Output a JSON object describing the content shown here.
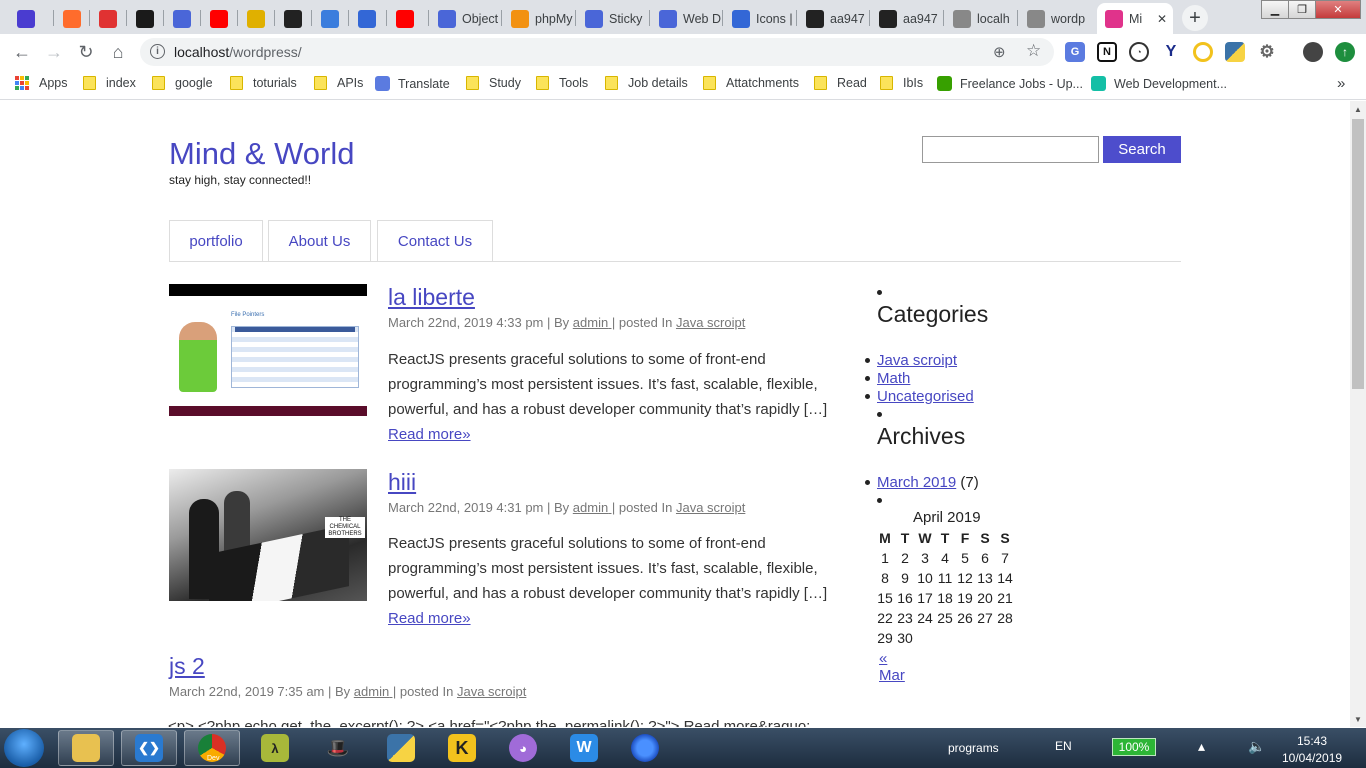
{
  "browser": {
    "tabs": [
      {
        "label": "",
        "icon": "yahoo-icon",
        "color": "#4a3cd0"
      },
      {
        "label": "",
        "icon": "cpanel-icon",
        "color": "#ff6c2c"
      },
      {
        "label": "",
        "icon": "ox-icon",
        "color": "#e03232"
      },
      {
        "label": "",
        "icon": "marker-icon",
        "color": "#1a1a1a"
      },
      {
        "label": "",
        "icon": "link-icon",
        "color": "#4a66d8"
      },
      {
        "label": "",
        "icon": "youtube-icon",
        "color": "#ff0000"
      },
      {
        "label": "",
        "icon": "crown-icon",
        "color": "#e0b000"
      },
      {
        "label": "",
        "icon": "w-icon",
        "color": "#222"
      },
      {
        "label": "",
        "icon": "phone-icon",
        "color": "#3b7ddd"
      },
      {
        "label": "",
        "icon": "flag-icon",
        "color": "#3367d6"
      },
      {
        "label": "",
        "icon": "youtube-icon",
        "color": "#ff0000"
      },
      {
        "label": "Object",
        "icon": "link-icon",
        "color": "#4a66d8"
      },
      {
        "label": "phpMy",
        "icon": "phpmyadmin-icon",
        "color": "#f29111"
      },
      {
        "label": "Sticky",
        "icon": "link-icon",
        "color": "#4a66d8"
      },
      {
        "label": "Web D",
        "icon": "link-icon",
        "color": "#4a66d8"
      },
      {
        "label": "Icons |",
        "icon": "flag-icon",
        "color": "#3367d6"
      },
      {
        "label": "aa947",
        "icon": "github-icon",
        "color": "#222"
      },
      {
        "label": "aa947",
        "icon": "github-icon",
        "color": "#222"
      },
      {
        "label": "localh",
        "icon": "globe-icon",
        "color": "#888"
      },
      {
        "label": "wordp",
        "icon": "globe-icon",
        "color": "#888"
      },
      {
        "label": "Mi",
        "icon": "m-icon",
        "color": "#e0338b",
        "active": true
      }
    ],
    "url_host": "localhost",
    "url_path": "/wordpress/",
    "bookmarks": [
      {
        "label": "Apps",
        "type": "apps"
      },
      {
        "label": "index",
        "type": "folder"
      },
      {
        "label": "google",
        "type": "folder"
      },
      {
        "label": "toturials",
        "type": "folder"
      },
      {
        "label": "APIs",
        "type": "folder"
      },
      {
        "label": "Translate",
        "type": "translate"
      },
      {
        "label": "Study",
        "type": "folder"
      },
      {
        "label": "Tools",
        "type": "folder"
      },
      {
        "label": "Job details",
        "type": "folder"
      },
      {
        "label": "Attatchments",
        "type": "folder"
      },
      {
        "label": "Read",
        "type": "folder"
      },
      {
        "label": "IbIs",
        "type": "folder"
      },
      {
        "label": "Freelance Jobs - Up...",
        "type": "upwork"
      },
      {
        "label": "Web Development...",
        "type": "web"
      }
    ],
    "more_bookmarks": "»"
  },
  "site": {
    "title": "Mind & World",
    "tagline": "stay high, stay connected!!",
    "search_button": "Search",
    "search_value": "",
    "menu": [
      "portfolio",
      "About Us",
      "Contact Us"
    ]
  },
  "posts": [
    {
      "title": "la liberte",
      "date": "March 22nd, 2019 4:33 pm",
      "by": "By",
      "author": "admin",
      "posted_in": "posted In",
      "category": "Java scroipt",
      "excerpt": "ReactJS presents graceful solutions to some of front-end programming’s most persistent issues. It’s fast, scalable, flexible, powerful, and has a robust developer community that’s rapidly […]",
      "read_more": "Read more»",
      "thumb_text": "File Pointers"
    },
    {
      "title": "hiii",
      "date": "March 22nd, 2019 4:31 pm",
      "by": "By",
      "author": "admin",
      "posted_in": "posted In",
      "category": "Java scroipt",
      "excerpt": "ReactJS presents graceful solutions to some of front-end programming’s most persistent issues. It’s fast, scalable, flexible, powerful, and has a robust developer community that’s rapidly […]",
      "read_more": "Read more»",
      "thumb_text": "THE CHEMICAL BROTHERS"
    },
    {
      "title": "js 2",
      "date": "March 22nd, 2019 7:35 am",
      "by": "By",
      "author": "admin",
      "posted_in": "posted In",
      "category": "Java scroipt",
      "code_excerpt": "<p> <?php echo get_the_excerpt(); ?> <a href=\"<?php the_permalink(); ?>\"> Read more&raquo;"
    }
  ],
  "sidebar": {
    "categories_title": "Categories",
    "categories": [
      "Java scroipt",
      "Math",
      "Uncategorised"
    ],
    "archives_title": "Archives",
    "archives": [
      {
        "label": "March 2019",
        "count": "(7)"
      }
    ],
    "calendar": {
      "caption": "April 2019",
      "headers": [
        "M",
        "T",
        "W",
        "T",
        "F",
        "S",
        "S"
      ],
      "weeks": [
        [
          "1",
          "2",
          "3",
          "4",
          "5",
          "6",
          "7"
        ],
        [
          "8",
          "9",
          "10",
          "11",
          "12",
          "13",
          "14"
        ],
        [
          "15",
          "16",
          "17",
          "18",
          "19",
          "20",
          "21"
        ],
        [
          "22",
          "23",
          "24",
          "25",
          "26",
          "27",
          "28"
        ],
        [
          "29",
          "30",
          "",
          "",
          "",
          "",
          ""
        ]
      ],
      "prev": "« Mar"
    }
  },
  "taskbar": {
    "toolbar_label": "programs",
    "language": "EN",
    "battery": "100%",
    "time": "15:43",
    "date": "10/04/2019",
    "chrome_label": "Dev"
  }
}
